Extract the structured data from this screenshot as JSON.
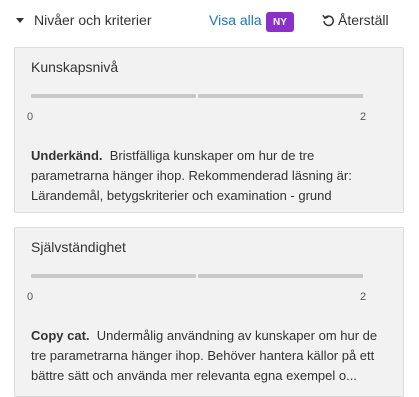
{
  "header": {
    "title": "Nivåer och kriterier",
    "show_all": "Visa alla",
    "badge": "NY",
    "reset": "Återställ",
    "badge_color": "#8b2fc9",
    "link_color": "#1a73c9"
  },
  "criteria": [
    {
      "title": "Kunskapsnivå",
      "min": "0",
      "max": "2",
      "level_name": "Underkänd.",
      "description": "Bristfälliga kunskaper om hur de tre parametrarna hänger ihop. Rekommenderad läsning är: Lärandemål, betygskriterier och examination - grund"
    },
    {
      "title": "Självständighet",
      "min": "0",
      "max": "2",
      "level_name": "Copy cat.",
      "description": "Undermålig användning av kunskaper om hur de tre parametrarna hänger ihop. Behöver hantera källor på ett bättre sätt och använda mer relevanta egna exempel o..."
    }
  ]
}
